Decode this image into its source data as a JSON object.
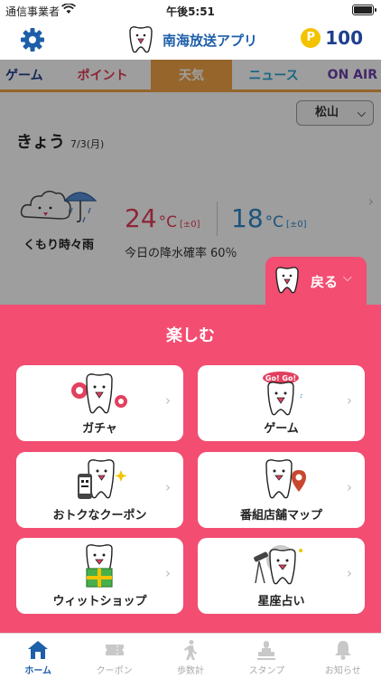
{
  "status_bar": {
    "carrier": "通信事業者",
    "time": "午後5:51"
  },
  "header": {
    "app_name": "南海放送アプリ",
    "points_symbol": "P",
    "points": "100"
  },
  "tabs": [
    {
      "label": "ゲーム"
    },
    {
      "label": "ポイント"
    },
    {
      "label": "天気",
      "active": true
    },
    {
      "label": "ニュース"
    },
    {
      "label": "ON AIR"
    }
  ],
  "weather": {
    "region": "松山",
    "today_label": "きょう",
    "date": "7/3(月)",
    "condition": "くもり時々雨",
    "high": {
      "value": "24",
      "unit": "°C",
      "diff": "[±0]"
    },
    "low": {
      "value": "18",
      "unit": "°C",
      "diff": "[±0]"
    },
    "rain_label": "今日の降水確率",
    "rain_value": "60％"
  },
  "back_button": {
    "label": "戻る"
  },
  "panel": {
    "title": "楽しむ",
    "cards": [
      {
        "label": "ガチャ",
        "icon": "gacha-mascot-icon"
      },
      {
        "label": "ゲーム",
        "icon": "game-mascot-icon",
        "badge": "Go! Go!"
      },
      {
        "label": "おトクなクーポン",
        "icon": "coupon-mascot-icon"
      },
      {
        "label": "番組店舗マップ",
        "icon": "map-mascot-icon"
      },
      {
        "label": "ウィットショップ",
        "icon": "shop-mascot-icon"
      },
      {
        "label": "星座占い",
        "icon": "horoscope-mascot-icon"
      }
    ]
  },
  "bottom_nav": [
    {
      "label": "ホーム",
      "icon": "home-icon",
      "active": true
    },
    {
      "label": "クーポン",
      "icon": "ticket-icon"
    },
    {
      "label": "歩数計",
      "icon": "walker-icon"
    },
    {
      "label": "スタンプ",
      "icon": "stamp-icon"
    },
    {
      "label": "お知らせ",
      "icon": "bell-icon"
    }
  ],
  "colors": {
    "brand_blue": "#1d5fa9",
    "pink": "#f34d72",
    "orange": "#f1a347",
    "temp_high": "#e23e5a",
    "temp_low": "#2f86c7"
  }
}
